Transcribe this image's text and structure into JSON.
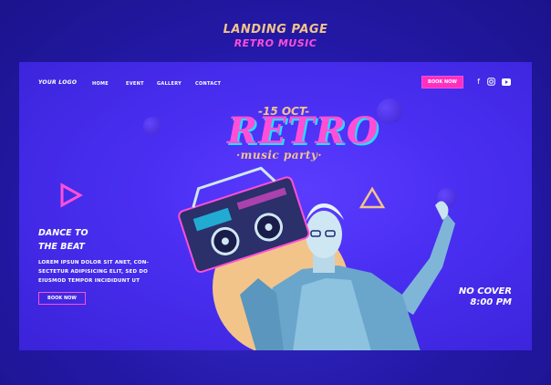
{
  "header": {
    "line1": "LANDING PAGE",
    "line2": "RETRO MUSIC"
  },
  "nav": {
    "logo": "YOUR LOGO",
    "links": [
      "HOME",
      "EVENT",
      "GALLERY",
      "CONTACT"
    ],
    "cta": "BOOK NOW",
    "social": [
      "facebook-icon",
      "instagram-icon",
      "youtube-icon"
    ]
  },
  "hero": {
    "date": "-15 OCT-",
    "title": "RETRO",
    "subtitle": "·music party·",
    "headline_line1": "DANCE TO",
    "headline_line2": "THE BEAT",
    "body_line1": "LOREM IPSUN DOLOR SIT ANET, CON-",
    "body_line2": "SECTETUR ADIPISICING  ELIT, SED DO",
    "body_line3": "EIUSMOD TEMPOR INCIDIDUNT UT",
    "cta": "BOOK NOW",
    "info_line1": "NO COVER",
    "info_line2": "8:00 PM"
  },
  "colors": {
    "background": "#2a1fb0",
    "panel": "#4a2ff2",
    "pink": "#ff4fd8",
    "peach": "#f3c48a",
    "cyan": "#1fe0ff"
  }
}
